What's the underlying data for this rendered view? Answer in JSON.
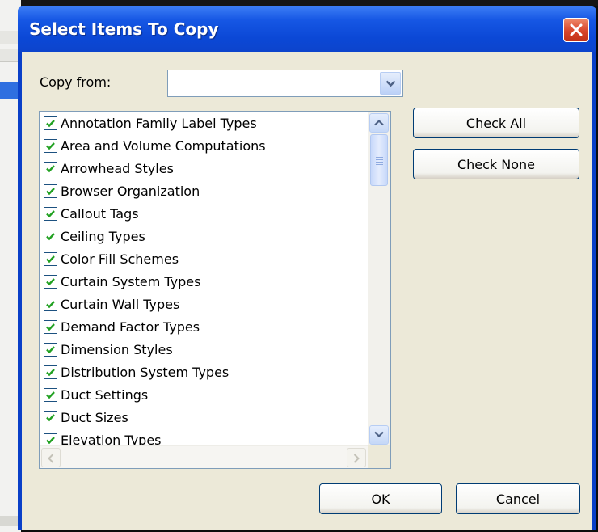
{
  "dialog": {
    "title": "Select Items To Copy",
    "copy_from_label": "Copy from:",
    "copy_from_value": "",
    "items": [
      {
        "label": "Annotation Family Label Types",
        "checked": true
      },
      {
        "label": "Area and Volume Computations",
        "checked": true
      },
      {
        "label": "Arrowhead Styles",
        "checked": true
      },
      {
        "label": "Browser Organization",
        "checked": true
      },
      {
        "label": "Callout Tags",
        "checked": true
      },
      {
        "label": "Ceiling Types",
        "checked": true
      },
      {
        "label": "Color Fill Schemes",
        "checked": true
      },
      {
        "label": "Curtain System Types",
        "checked": true
      },
      {
        "label": "Curtain Wall Types",
        "checked": true
      },
      {
        "label": "Demand Factor Types",
        "checked": true
      },
      {
        "label": "Dimension Styles",
        "checked": true
      },
      {
        "label": "Distribution System Types",
        "checked": true
      },
      {
        "label": "Duct Settings",
        "checked": true
      },
      {
        "label": "Duct Sizes",
        "checked": true
      },
      {
        "label": "Elevation Types",
        "checked": true
      }
    ],
    "buttons": {
      "check_all": "Check All",
      "check_none": "Check None",
      "ok": "OK",
      "cancel": "Cancel"
    }
  },
  "icons": {
    "close": "close-icon",
    "dropdown": "chevron-down-icon",
    "scroll_up": "scroll-up-arrow-icon",
    "scroll_down": "scroll-down-arrow-icon",
    "scroll_left": "scroll-left-arrow-icon",
    "scroll_right": "scroll-right-arrow-icon",
    "checkbox": "checkmark-icon"
  },
  "colors": {
    "title_bar": "#0b48d6",
    "close_button": "#d8452a",
    "dialog_face": "#ece9d8",
    "check_mark": "#21a121"
  }
}
